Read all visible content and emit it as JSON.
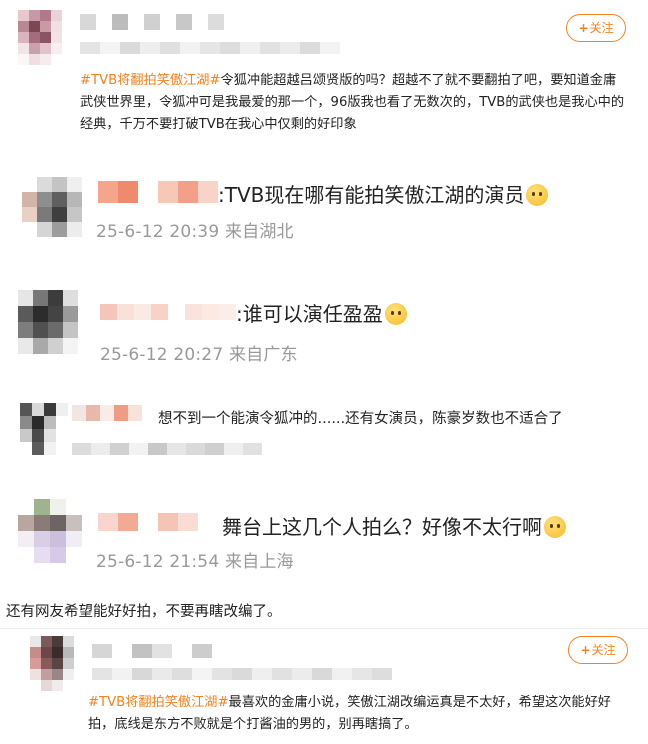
{
  "follow_label": "关注",
  "follow_plus": "+",
  "post1": {
    "hashtag": "#TVB将翻拍笑傲江湖#",
    "text": "令狐冲能超越吕颂贤版的吗？超越不了就不要翻拍了吧，要知道金庸武侠世界里，令狐冲可是我最爱的那一个，96版我也看了无数次的，TVB的武侠也是我心中的经典，千万不要打破TVB在我心中仅剩的好印象"
  },
  "replies": [
    {
      "text": ":TVB现在哪有能拍笑傲江湖的演员",
      "meta": "25-6-12 20:39 来自湖北"
    },
    {
      "text": ":谁可以演任盈盈",
      "meta": "25-6-12 20:27 来自广东"
    },
    {
      "text": "想不到一个能演令狐冲的......还有女演员，陈豪岁数也不适合了",
      "meta": ""
    },
    {
      "text": "舞台上这几个人拍么？好像不太行啊",
      "meta": "25-6-12 21:54 来自上海"
    }
  ],
  "standalone_text": "还有网友希望能好好拍，不要再瞎改编了。",
  "post2": {
    "hashtag": "#TVB将翻拍笑傲江湖#",
    "text": "最喜欢的金庸小说，笑傲江湖改编运真是不太好，希望这次能好好拍，底线是东方不败就是个打酱油的男的，别再瞎搞了。"
  },
  "colors": {
    "accent": "#f58220",
    "meta": "#999999",
    "text": "#222222"
  },
  "icons": {
    "reply1": "thinking-emoji",
    "reply2": "smirk-emoji",
    "reply4": "laughing-tears-emoji"
  }
}
